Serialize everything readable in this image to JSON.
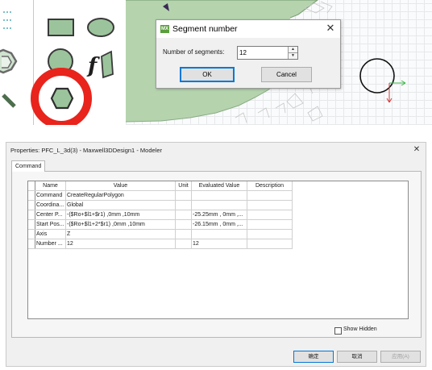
{
  "segment_dialog": {
    "title": "Segment number",
    "app_icon_text": "MX",
    "field_label": "Number of segments:",
    "segments_value": "12",
    "ok_label": "OK",
    "cancel_label": "Cancel"
  },
  "properties_window": {
    "title": "Properties: PFC_L_3d(3) - Maxwell3DDesign1 - Modeler",
    "tab_label": "Command",
    "columns": [
      "Name",
      "Value",
      "Unit",
      "Evaluated Value",
      "Description"
    ],
    "rows": [
      {
        "name": "Command",
        "value": "CreateRegularPolygon",
        "unit": "",
        "evaluated": "",
        "description": ""
      },
      {
        "name": "Coordina...",
        "value": "Global",
        "unit": "",
        "evaluated": "",
        "description": ""
      },
      {
        "name": "Center P...",
        "value": "-($Ro+$l1+$r1) ,0mm ,10mm",
        "unit": "",
        "evaluated": "-25.25mm , 0mm ,...",
        "description": ""
      },
      {
        "name": "Start Pos...",
        "value": "-($Ro+$l1+2*$r1) ,0mm ,10mm",
        "unit": "",
        "evaluated": "-26.15mm , 0mm ,...",
        "description": ""
      },
      {
        "name": "Axis",
        "value": "Z",
        "unit": "",
        "evaluated": "",
        "description": ""
      },
      {
        "name": "Number ...",
        "value": "12",
        "unit": "",
        "evaluated": "12",
        "description": ""
      }
    ],
    "show_hidden_label": "Show Hidden",
    "ok_label": "确定",
    "cancel_label": "取消",
    "apply_label": "应用(A)"
  },
  "colors": {
    "highlight_circle": "#e8241c",
    "shape_fill": "#9cc49c",
    "model_green": "#b5d4ae",
    "axis_x": "#38b844",
    "axis_y": "#d23c3c"
  },
  "icons": [
    "rectangle-icon",
    "ellipse-icon",
    "regular-polygon-icon",
    "circle-icon",
    "equation-curve-icon",
    "polyline-icon",
    "close-icon"
  ]
}
